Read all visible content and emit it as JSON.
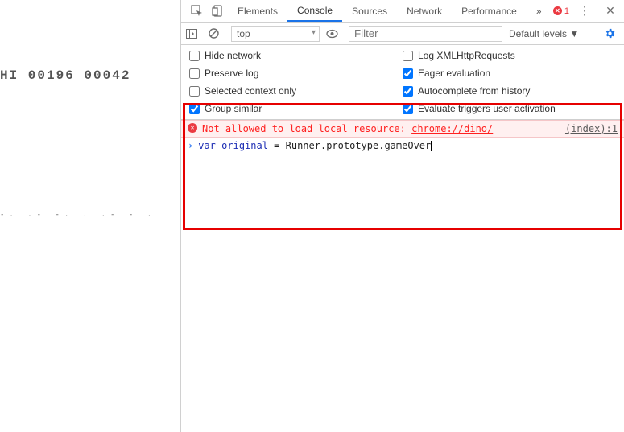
{
  "dino": {
    "score_label": "HI 00196 00042",
    "ground": "-. .-  -.  .   .-  -  ."
  },
  "tabs": {
    "elements": "Elements",
    "console": "Console",
    "sources": "Sources",
    "network": "Network",
    "performance": "Performance",
    "more": "»"
  },
  "error_count": "1",
  "toolbar": {
    "context": "top",
    "filter_placeholder": "Filter",
    "levels": "Default levels ▼"
  },
  "settings": {
    "hide_network": {
      "label": "Hide network",
      "checked": false
    },
    "log_xhr": {
      "label": "Log XMLHttpRequests",
      "checked": false
    },
    "preserve_log": {
      "label": "Preserve log",
      "checked": false
    },
    "eager_eval": {
      "label": "Eager evaluation",
      "checked": true
    },
    "selected_ctx_only": {
      "label": "Selected context only",
      "checked": false
    },
    "autocomplete_hist": {
      "label": "Autocomplete from history",
      "checked": true
    },
    "group_similar": {
      "label": "Group similar",
      "checked": true
    },
    "eval_triggers": {
      "label": "Evaluate triggers user activation",
      "checked": true
    }
  },
  "console": {
    "error_msg_prefix": "Not allowed to load local resource: ",
    "error_msg_url": "chrome://dino/",
    "error_source": "(index):1",
    "input_kw": "var",
    "input_ident": "original",
    "input_rest": " = Runner.prototype.gameOver"
  }
}
